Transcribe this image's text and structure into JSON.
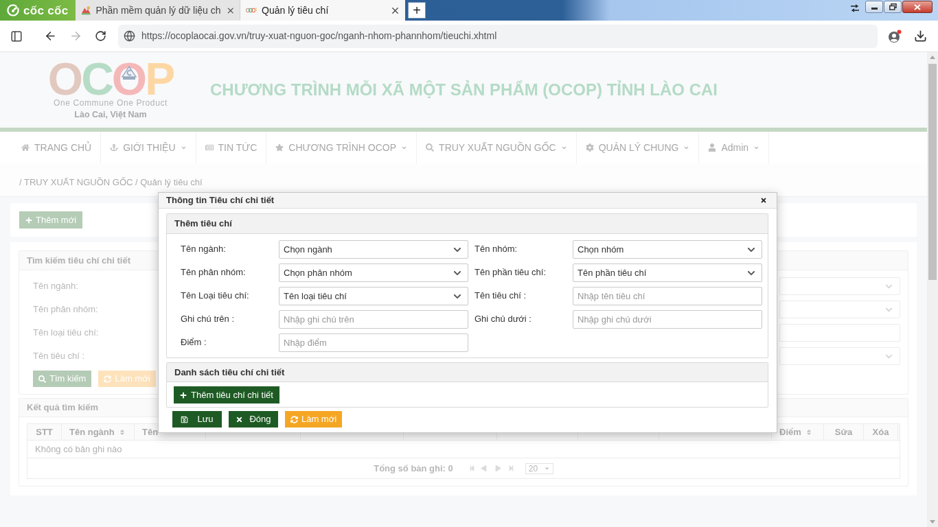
{
  "browser": {
    "brand": "cốc cốc",
    "tabs": [
      {
        "title": "Phần mềm quản lý dữ liệu ch",
        "kind": "software",
        "selected": false
      },
      {
        "title": "Quản lý tiêu chí",
        "kind": "ocop",
        "selected": true
      }
    ],
    "new_tab": "+",
    "url": "https://ocoplaocai.gov.vn/truy-xuat-nguon-goc/nganh-nhom-phannhom/tieuchi.xhtml"
  },
  "header": {
    "logo": {
      "wordmark": "OCOP",
      "tagline": "One Commune One Product",
      "place": "Lào Cai, Việt Nam"
    },
    "title": "CHƯƠNG TRÌNH MỖI XÃ MỘT SẢN PHẨM (OCOP) TỈNH LÀO CAI"
  },
  "nav": [
    {
      "label": "TRANG CHỦ",
      "kind": "home",
      "has_menu": false
    },
    {
      "label": "GIỚI THIỆU",
      "kind": "about",
      "has_menu": true
    },
    {
      "label": "TIN TỨC",
      "kind": "news",
      "has_menu": false
    },
    {
      "label": "CHƯƠNG TRÌNH OCOP",
      "kind": "program",
      "has_menu": true
    },
    {
      "label": "TRUY XUẤT NGUỒN GỐC",
      "kind": "trace",
      "has_menu": true
    },
    {
      "label": "QUẢN LÝ CHUNG",
      "kind": "manage",
      "has_menu": true
    },
    {
      "label": "Admin",
      "kind": "account",
      "has_menu": true
    }
  ],
  "breadcrumb": "/ TRUY XUẤT NGUỒN GỐC / Quản lý tiêu chí",
  "add_button": "Thêm mới",
  "search_panel": {
    "title": "Tìm kiếm tiêu chí chi tiết",
    "labels": [
      "Tên ngành:",
      "Tên phân nhóm:",
      "Tên loại tiêu chí:",
      "Tên tiêu chí :"
    ],
    "right_fields": [
      {
        "kind": "select"
      },
      {
        "kind": "select"
      },
      {
        "kind": "input"
      },
      {
        "kind": "select"
      }
    ],
    "buttons": [
      {
        "label": "Tìm kiếm",
        "kind": "search"
      },
      {
        "label": "Làm mới",
        "kind": "reset"
      }
    ]
  },
  "results_panel": {
    "title": "Kết quả tìm kiếm",
    "columns": [
      {
        "label": "STT",
        "sortable": false
      },
      {
        "label": "Tên ngành",
        "sortable": true
      },
      {
        "label": "Tên",
        "sortable": false
      },
      {},
      {},
      {},
      {},
      {},
      {},
      {
        "label": "Điểm",
        "sortable": true
      },
      {
        "label": "Sửa",
        "sortable": false
      },
      {
        "label": "Xóa",
        "sortable": false
      }
    ],
    "empty_text": "Không có bản ghi nào",
    "total": "Tổng số bản ghi: 0",
    "page_size": "20"
  },
  "modal": {
    "title": "Thông tin Tiêu chí chi tiết",
    "form": {
      "title": "Thêm tiêu chí",
      "fields": [
        {
          "label": "Tên ngành:",
          "kind": "select",
          "value": "Chọn ngành"
        },
        {
          "label": "Tên nhóm:",
          "kind": "select",
          "value": "Chọn nhóm"
        },
        {
          "label": "Tên phân nhóm:",
          "kind": "select",
          "value": "Chọn phân nhóm"
        },
        {
          "label": "Tên phần tiêu chí:",
          "kind": "select",
          "value": "Tên phần tiêu chí"
        },
        {
          "label": "Tên Loại tiêu chí:",
          "kind": "select",
          "value": "Tên loại tiêu chí"
        },
        {
          "label": "Tên tiêu chí :",
          "kind": "input",
          "placeholder": "Nhập tên tiêu chí"
        },
        {
          "label": "Ghi chú trên :",
          "kind": "input",
          "placeholder": "Nhập ghi chú trên"
        },
        {
          "label": "Ghi chú dưới :",
          "kind": "input",
          "placeholder": "Nhập ghi chú dưới"
        },
        {
          "label": "Điểm :",
          "kind": "input",
          "placeholder": "Nhập điểm"
        }
      ]
    },
    "list": {
      "title": "Danh sách tiêu chí chi tiết",
      "add_button": "Thêm tiêu chí chi tiết"
    },
    "buttons": [
      {
        "label": "Lưu",
        "kind": "save"
      },
      {
        "label": "Đóng",
        "kind": "close"
      },
      {
        "label": "Làm mới",
        "kind": "reset"
      }
    ]
  }
}
